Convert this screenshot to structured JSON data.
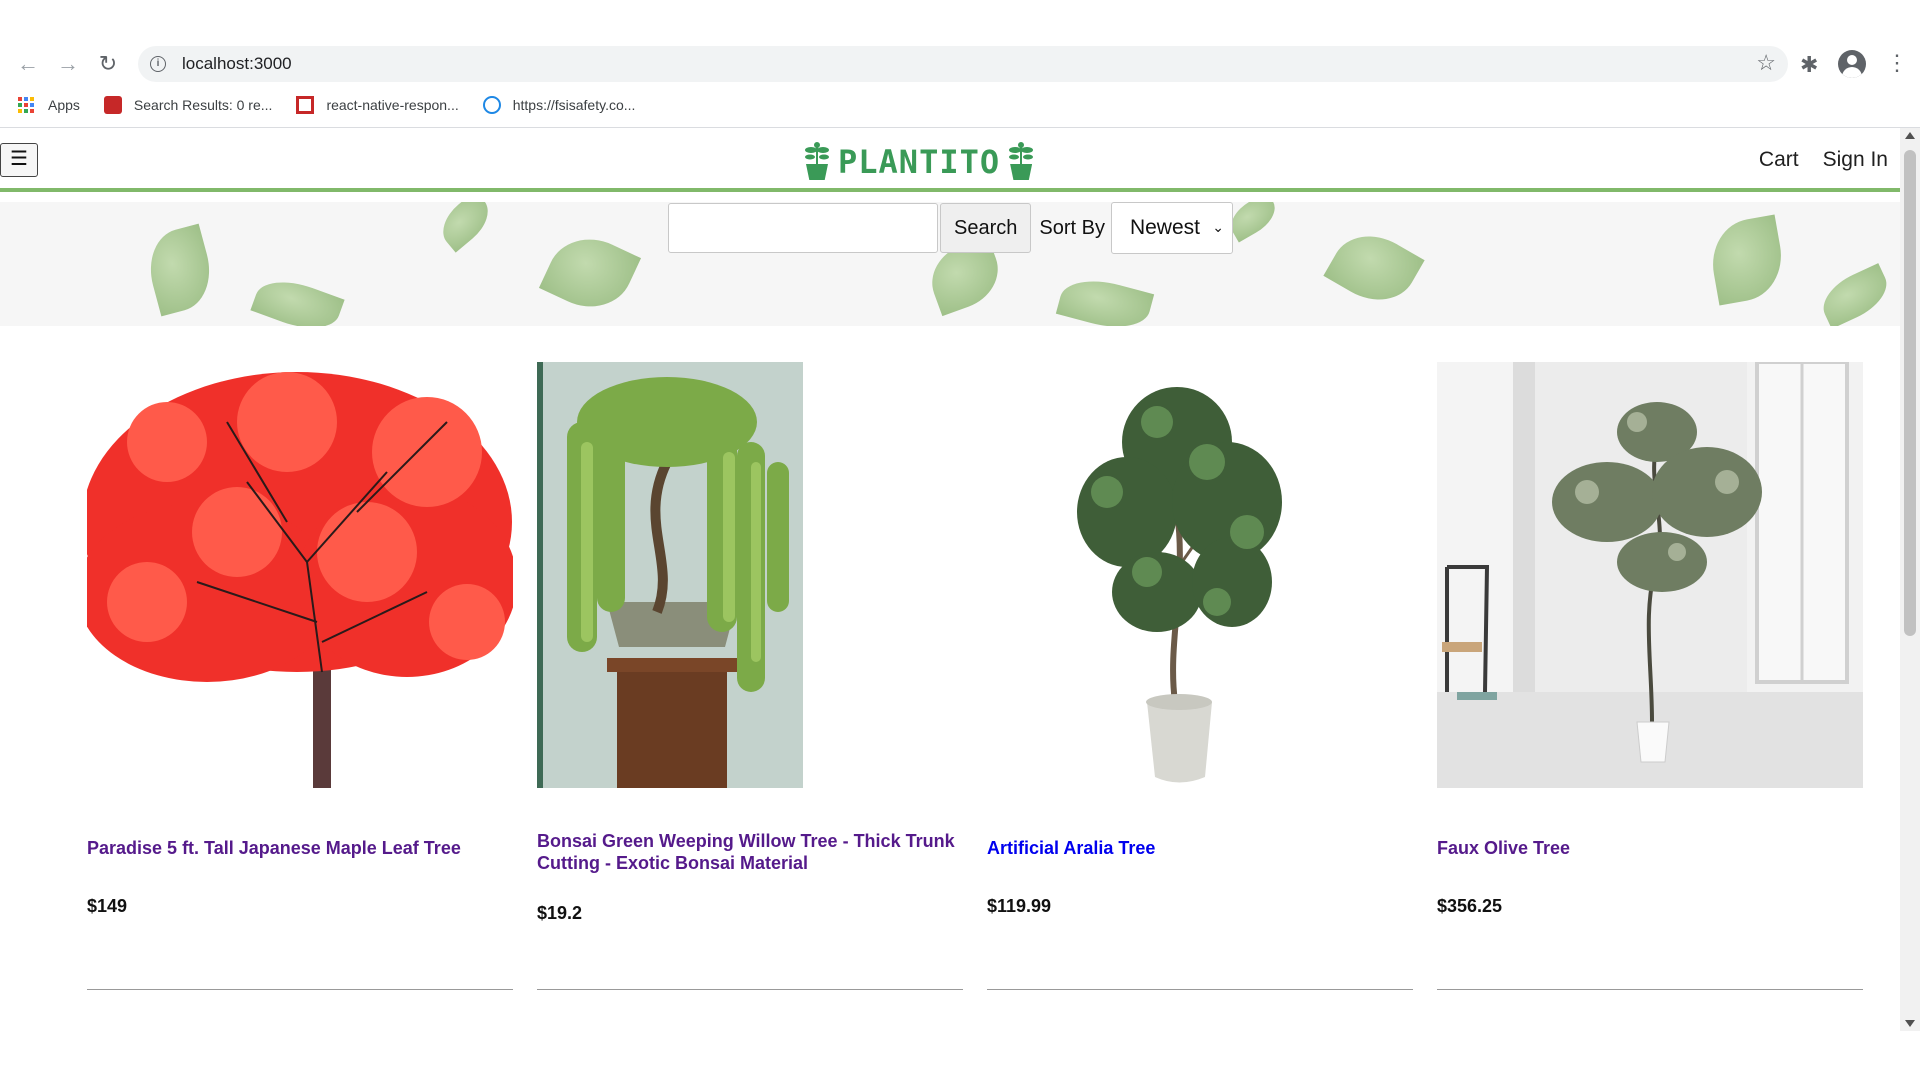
{
  "browser": {
    "url": "localhost:3000",
    "bookmarks": [
      {
        "label": "Apps"
      },
      {
        "label": "Search Results: 0 re..."
      },
      {
        "label": "react-native-respon..."
      },
      {
        "label": "https://fsisafety.co..."
      }
    ]
  },
  "header": {
    "logo_text": "PLANTITO",
    "menu_glyph": "☰",
    "links": [
      "Cart",
      "Sign In"
    ]
  },
  "search": {
    "input_value": "",
    "button_label": "Search",
    "sort_label": "Sort By",
    "sort_value": "Newest"
  },
  "products": [
    {
      "name": "Paradise 5 ft. Tall Japanese Maple Leaf Tree",
      "price": "$149"
    },
    {
      "name": "Bonsai Green Weeping Willow Tree - Thick Trunk Cutting - Exotic Bonsai Material",
      "price": "$19.2"
    },
    {
      "name": "Artificial Aralia Tree",
      "price": "$119.99"
    },
    {
      "name": "Faux Olive Tree",
      "price": "$356.25"
    }
  ],
  "colors": {
    "brand_green": "#3a9a57",
    "header_border": "#81b96a",
    "visited_link": "#551a8b",
    "unvisited_link": "#0000ee"
  }
}
